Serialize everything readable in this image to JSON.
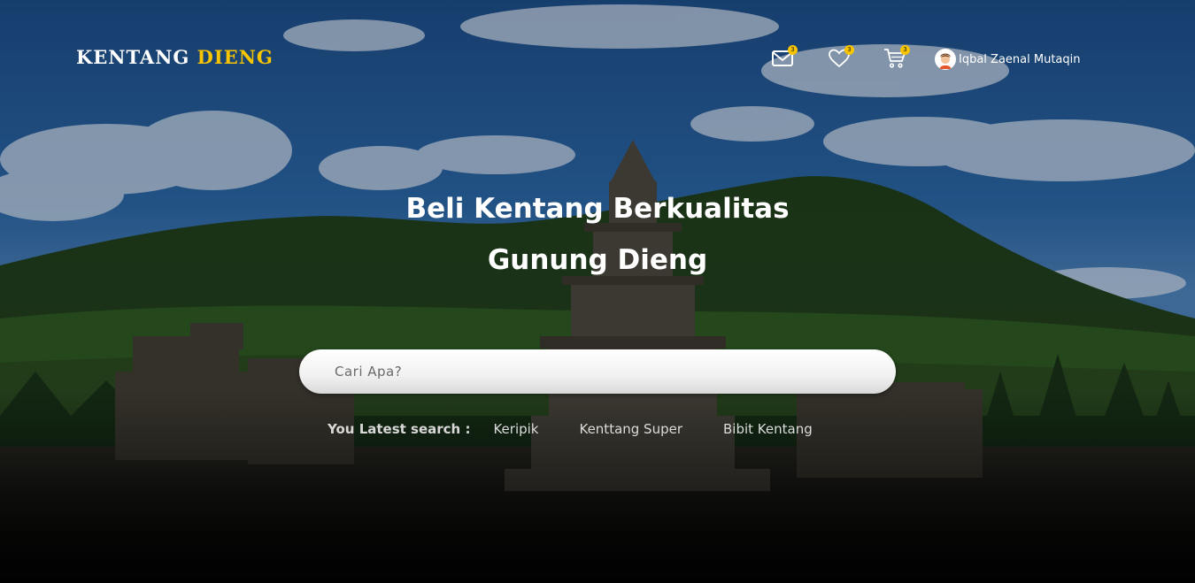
{
  "brand": {
    "part1": "KENTANG",
    "part2": "DIENG",
    "accent_color": "#f7c400"
  },
  "nav": {
    "mail": {
      "icon": "mail-icon",
      "badge": "3"
    },
    "wishlist": {
      "icon": "heart-icon",
      "badge": "3"
    },
    "cart": {
      "icon": "cart-icon",
      "badge": "3"
    },
    "user": {
      "icon": "avatar-icon",
      "name": "Iqbal Zaenal Mutaqin"
    }
  },
  "hero": {
    "title_line1": "Beli Kentang Berkualitas",
    "title_line2": "Gunung Dieng"
  },
  "search": {
    "placeholder": "Cari Apa?"
  },
  "latest_search": {
    "label": "You Latest search :",
    "items": [
      "Keripik",
      "Kenttang Super",
      "Bibit Kentang"
    ]
  }
}
